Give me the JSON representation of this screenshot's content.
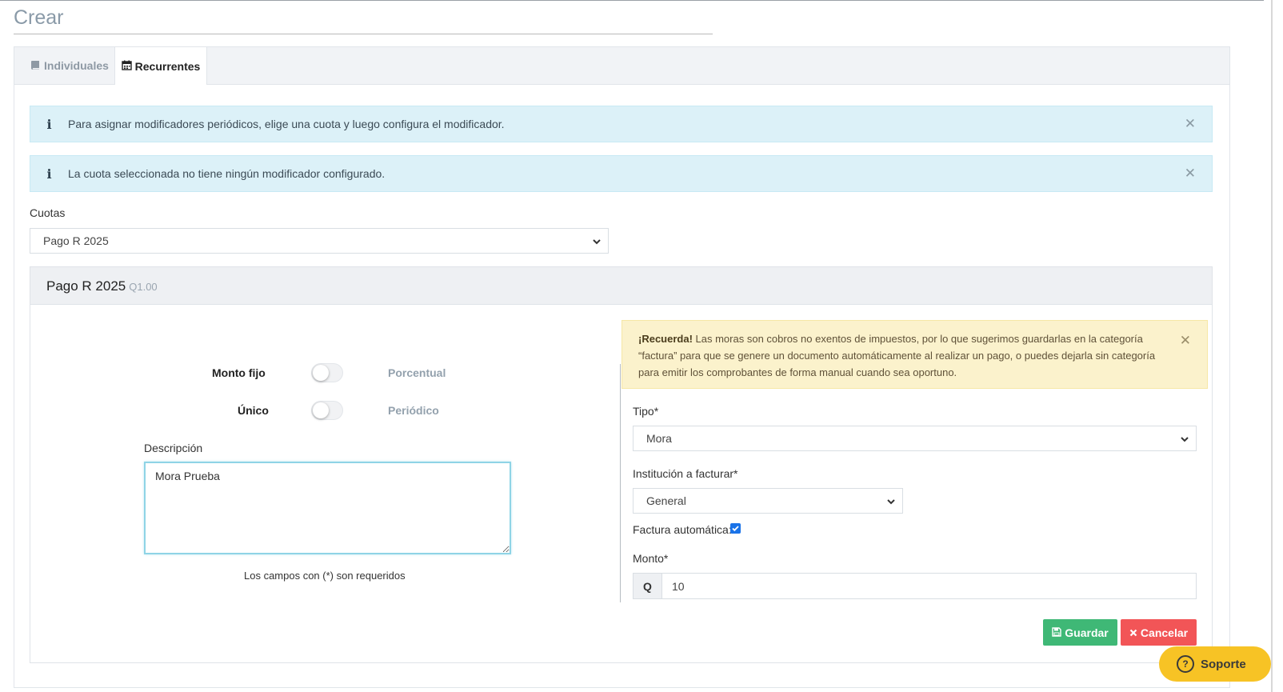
{
  "page": {
    "title": "Crear"
  },
  "tabs": [
    {
      "label": "Individuales",
      "icon": "book-icon"
    },
    {
      "label": "Recurrentes",
      "icon": "calendar-icon"
    }
  ],
  "alerts": [
    {
      "text": "Para asignar modificadores periódicos, elige una cuota y luego configura el modificador."
    },
    {
      "text": "La cuota seleccionada no tiene ningún modificador configurado."
    }
  ],
  "cuotas": {
    "label": "Cuotas",
    "selected": "Pago R 2025"
  },
  "card": {
    "title": "Pago R 2025",
    "amount": "Q1.00"
  },
  "toggles": [
    {
      "left_label": "Monto fijo",
      "right_label": "Porcentual",
      "on": false
    },
    {
      "left_label": "Único",
      "right_label": "Periódico",
      "on": false
    }
  ],
  "descripcion": {
    "label": "Descripción",
    "value": "Mora Prueba"
  },
  "required_note": "Los campos con (*) son requeridos",
  "warning": {
    "strong": "¡Recuerda!",
    "text": " Las moras son cobros no exentos de impuestos, por lo que sugerimos guardarlas en la categoría “factura” para que se genere un documento automáticamente al realizar un pago, o puedes dejarla sin categoría para emitir los comprobantes de forma manual cuando sea oportuno."
  },
  "tipo": {
    "label": "Tipo*",
    "selected": "Mora"
  },
  "institucion": {
    "label": "Institución a facturar*",
    "selected": "General"
  },
  "factura_automatica": {
    "label": "Factura automática:",
    "checked": true
  },
  "monto": {
    "label": "Monto*",
    "prefix": "Q",
    "value": "10"
  },
  "buttons": {
    "save": "Guardar",
    "cancel": "Cancelar"
  },
  "support": {
    "label": "Soporte"
  },
  "colors": {
    "save": "#3fb876",
    "cancel": "#f25557",
    "info_bg": "#dcf1f8",
    "warning_bg": "#fbf2cc",
    "support": "#f7c325"
  }
}
